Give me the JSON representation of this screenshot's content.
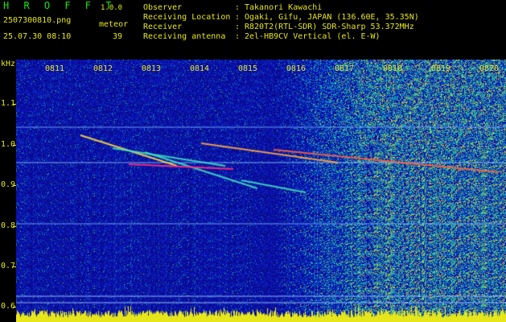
{
  "app": {
    "name": "H R O F F T",
    "version": "1.0.0"
  },
  "file_name": "2507300810.png",
  "meteor_label": "meteor",
  "datetime": "25.07.30 08:10",
  "meteor_count": "39",
  "info": [
    {
      "label": "Observer",
      "value": "Takanori Kawachi"
    },
    {
      "label": "Receiving Location",
      "value": "Ogaki, Gifu, JAPAN (136.60E, 35.35N)"
    },
    {
      "label": "Receiver",
      "value": "R820T2(RTL-SDR) SDR-Sharp 53.372MHz"
    },
    {
      "label": "Receiving antenna",
      "value": "2el-HB9CV Vertical (el. E-W)"
    }
  ],
  "info_separator": ":",
  "y_axis": {
    "unit": "kHz",
    "ticks": [
      "1.1",
      "1.0",
      "0.9",
      "0.8",
      "0.7",
      "0.6"
    ]
  },
  "x_axis": {
    "ticks": [
      "0811",
      "0812",
      "0813",
      "0814",
      "0815",
      "0816",
      "0817",
      "0818",
      "0819",
      "0820"
    ]
  },
  "colors": {
    "text": "#e6e61a",
    "title": "#17e60e",
    "background": "#0a0a6e"
  }
}
